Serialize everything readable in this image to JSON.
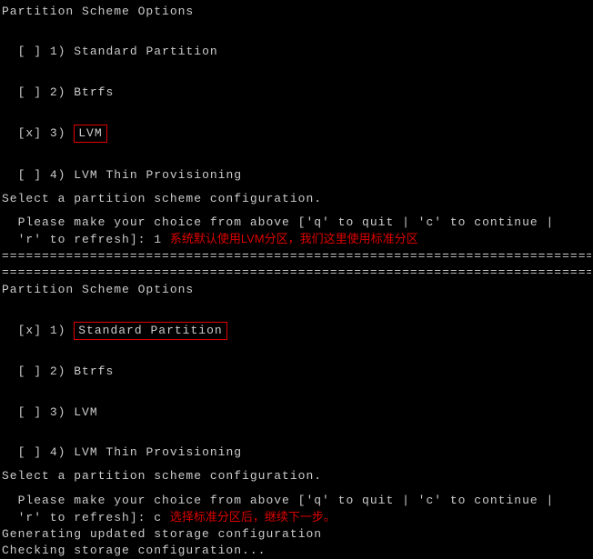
{
  "section1": {
    "title": "Partition Scheme Options",
    "options": [
      {
        "mark": "[ ]",
        "num": "1)",
        "label": "Standard Partition",
        "selected": false
      },
      {
        "mark": "[x]",
        "num": "3)",
        "label": "LVM",
        "selected": true
      },
      {
        "mark": "[ ]",
        "num": "2)",
        "label": "Btrfs",
        "selected": false
      },
      {
        "mark": "[ ]",
        "num": "4)",
        "label": "LVM Thin Provisioning",
        "selected": false
      }
    ],
    "prompt_intro": "Select a partition scheme configuration.",
    "prompt_line1": "  Please make your choice from above ['q' to quit | 'c' to continue |",
    "prompt_line2_prefix": "  'r' to refresh]: 1 ",
    "annotation": "系统默认使用LVM分区，我们这里使用标准分区"
  },
  "divider": "================================================================================",
  "section2": {
    "title": "Partition Scheme Options",
    "options": [
      {
        "mark": "[x]",
        "num": "1)",
        "label": "Standard Partition",
        "selected": true
      },
      {
        "mark": "[ ]",
        "num": "2)",
        "label": "Btrfs",
        "selected": false
      },
      {
        "mark": "[ ]",
        "num": "3)",
        "label": "LVM",
        "selected": false
      },
      {
        "mark": "[ ]",
        "num": "4)",
        "label": "LVM Thin Provisioning",
        "selected": false
      }
    ],
    "prompt_intro": "Select a partition scheme configuration.",
    "prompt_line1": "  Please make your choice from above ['q' to quit | 'c' to continue |",
    "prompt_line2_prefix": "  'r' to refresh]: c ",
    "annotation": "选择标准分区后，继续下一步。",
    "status1": "Generating updated storage configuration",
    "status2": "Checking storage configuration..."
  }
}
